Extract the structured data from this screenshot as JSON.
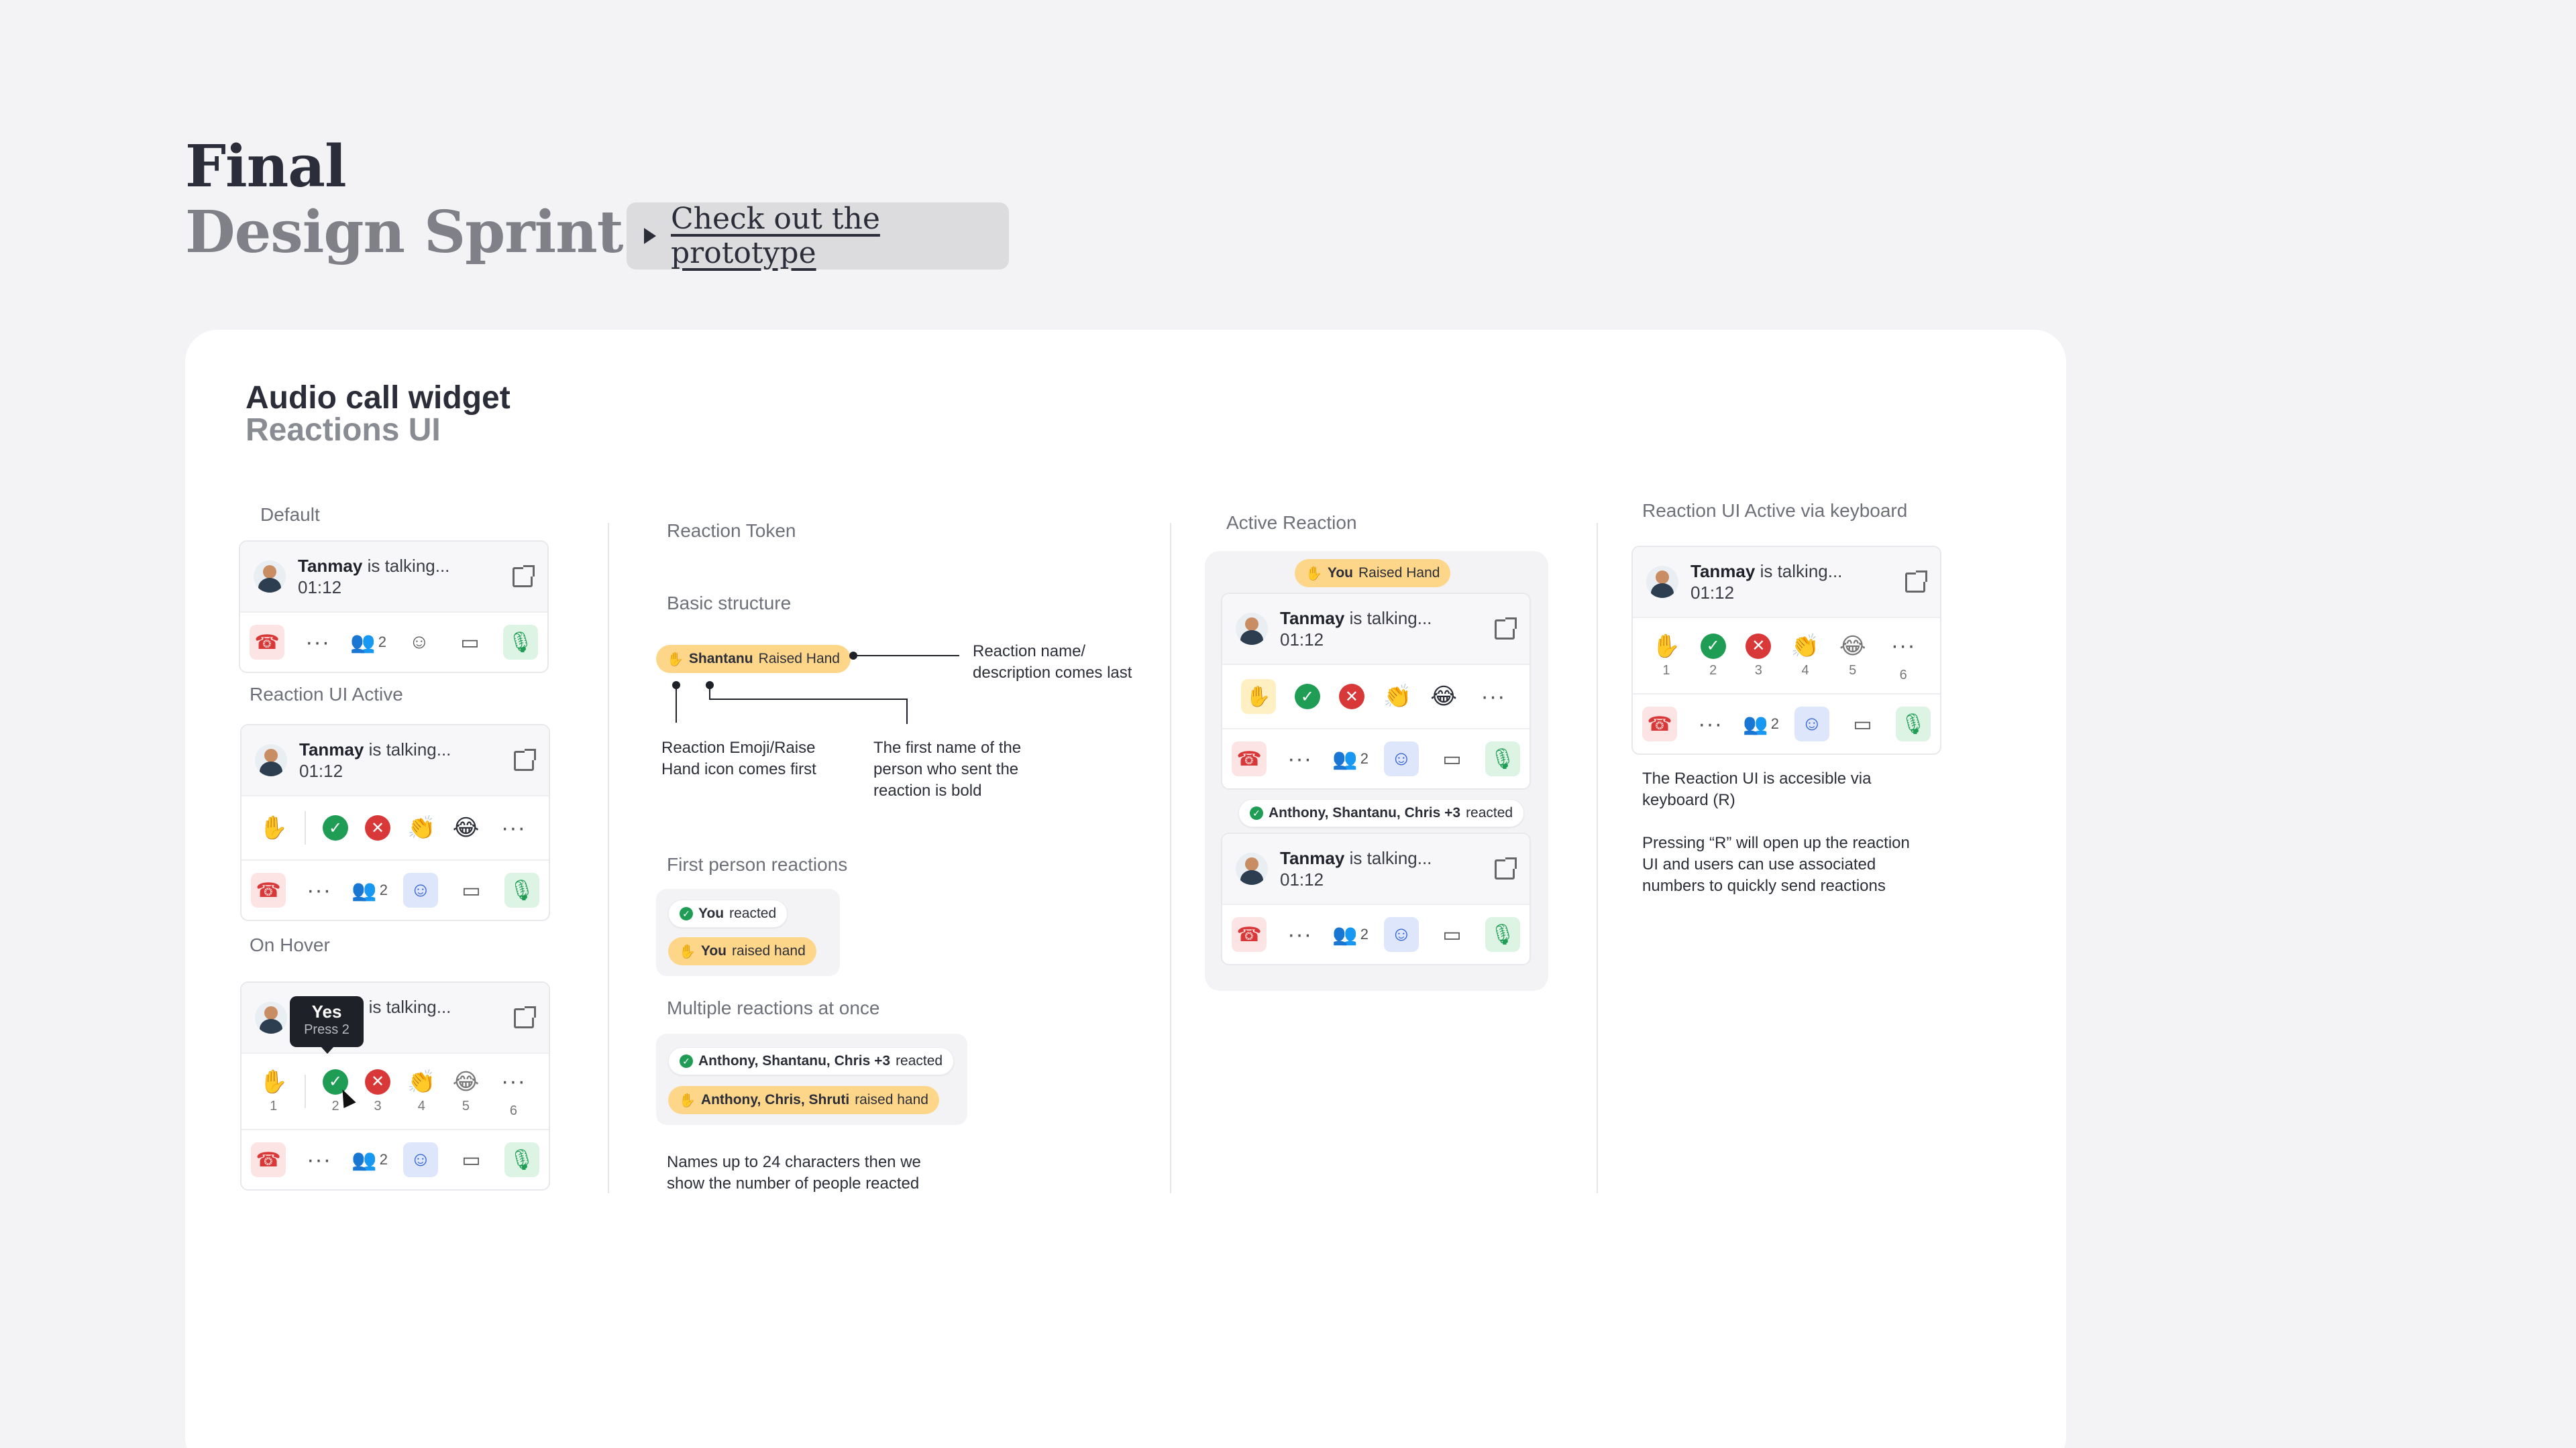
{
  "hero": {
    "title": "Final",
    "subtitle": "Design Sprint",
    "prototype_link": "Check out the prototype"
  },
  "card": {
    "title": "Audio call widget",
    "subtitle": "Reactions UI"
  },
  "widget": {
    "name": "Tanmay",
    "status": "is talking...",
    "time": "01:12",
    "participants": "2"
  },
  "reactions": {
    "numbers": [
      "1",
      "2",
      "3",
      "4",
      "5",
      "6"
    ]
  },
  "sections": {
    "default": "Default",
    "reaction_ui_active": "Reaction UI Active",
    "on_hover": "On Hover",
    "reaction_token": "Reaction Token",
    "basic_structure": "Basic structure",
    "first_person": "First person reactions",
    "multiple": "Multiple reactions at once",
    "active_reaction": "Active Reaction",
    "keyboard": "Reaction UI Active via keyboard"
  },
  "tooltip": {
    "title": "Yes",
    "hint": "Press 2"
  },
  "tokens": {
    "basic": {
      "name": "Shantanu",
      "action": "Raised Hand"
    },
    "first_reacted": {
      "name": "You",
      "action": "reacted"
    },
    "first_raised": {
      "name": "You",
      "action": "raised hand"
    },
    "multi_reacted": {
      "name": "Anthony, Shantanu, Chris +3",
      "action": "reacted"
    },
    "multi_raised": {
      "name": "Anthony, Chris, Shruti",
      "action": "raised hand"
    },
    "active_you": {
      "name": "You",
      "action": "Raised Hand"
    }
  },
  "notes": {
    "name_desc": "Reaction name/\ndescription comes last",
    "emoji_first": "Reaction Emoji/Raise\nHand icon comes first",
    "first_name_bold": "The first name of the\nperson who sent the\nreaction is bold",
    "names_limit": "Names up to 24 characters then we\nshow the number of people reacted",
    "keyboard_1": "The Reaction UI is accesible via\nkeyboard (R)",
    "keyboard_2": "Pressing “R” will open up the reaction\nUI and users can use associated\nnumbers to quickly send reactions"
  },
  "icons": [
    "play-icon",
    "end-call-icon",
    "more-icon",
    "participants-icon",
    "reaction-icon",
    "screen-share-icon",
    "mic-icon",
    "external-link-icon",
    "raise-hand-icon",
    "yes-icon",
    "no-icon",
    "clap-icon",
    "laugh-icon",
    "check-icon"
  ],
  "colors": {
    "end_call": "#d93838",
    "mic": "#1f9d55",
    "reaction_active": "#2e5fd8",
    "token_yellow": "#fdd68a"
  }
}
